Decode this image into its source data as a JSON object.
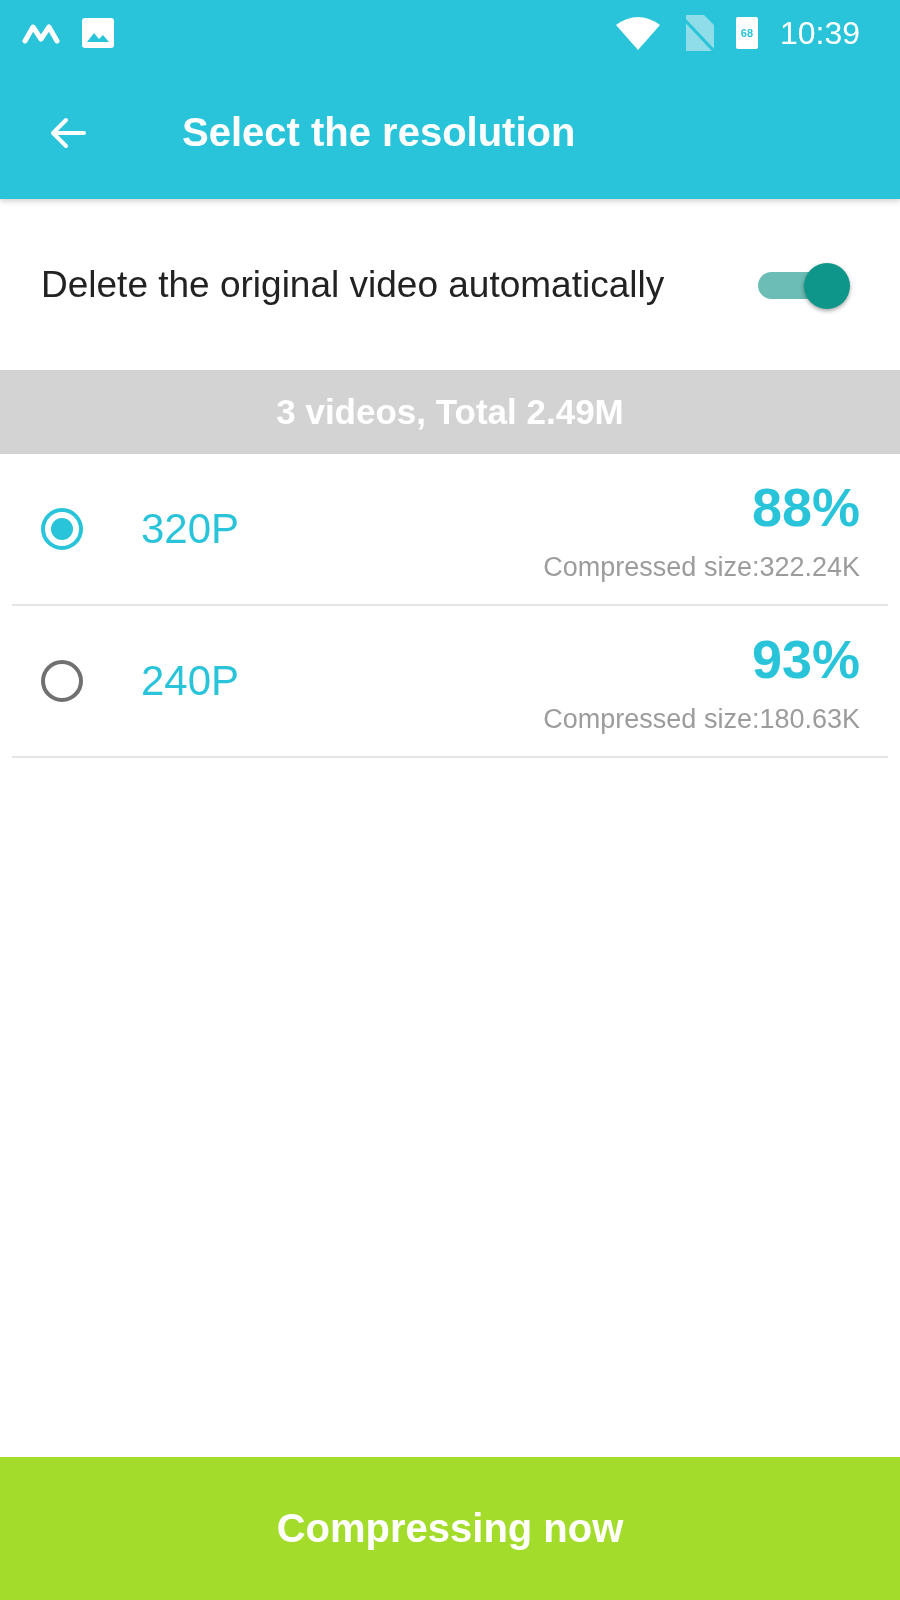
{
  "status_bar": {
    "battery_level_text": "68",
    "time": "10:39"
  },
  "app_bar": {
    "title": "Select the resolution"
  },
  "delete_option": {
    "label": "Delete the original video automatically",
    "on": true
  },
  "summary": "3 videos, Total 2.49M",
  "resolutions": [
    {
      "label": "320P",
      "selected": true,
      "percent": "88%",
      "size": "Compressed size:322.24K"
    },
    {
      "label": "240P",
      "selected": false,
      "percent": "93%",
      "size": "Compressed size:180.63K"
    }
  ],
  "action_button": "Compressing now"
}
